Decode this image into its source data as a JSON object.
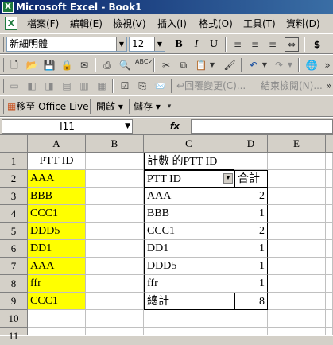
{
  "app": {
    "title": "Microsoft Excel - Book1",
    "logo_glyph": "X"
  },
  "menu": {
    "doc_glyph": "X",
    "items": [
      "檔案(F)",
      "編輯(E)",
      "檢視(V)",
      "插入(I)",
      "格式(O)",
      "工具(T)",
      "資料(D)"
    ]
  },
  "format_toolbar": {
    "font_name": "新細明體",
    "font_size": "12",
    "bold": "B",
    "italic": "I",
    "underline": "U",
    "dollar": "$"
  },
  "review_toolbar": {
    "reply_label": "回覆變更(C)...",
    "end_review_label": "結束檢閱(N)..."
  },
  "office_live_toolbar": {
    "goto_label": "移至 Office Live",
    "open_label": "開啟 ▾",
    "save_label": "儲存 ▾"
  },
  "formula_bar": {
    "name_box": "I11",
    "fx_label": "fx",
    "content": ""
  },
  "sheet": {
    "columns": [
      "A",
      "B",
      "C",
      "D",
      "E"
    ],
    "rows": [
      "1",
      "2",
      "3",
      "4",
      "5",
      "6",
      "7",
      "8",
      "9",
      "10",
      "11"
    ],
    "colA": [
      "PTT ID",
      "AAA",
      "BBB",
      "CCC1",
      "DDD5",
      "DD1",
      "AAA",
      "ffr",
      "CCC1"
    ],
    "pivot": {
      "title": "計數 的PTT ID",
      "row_field": "PTT ID",
      "total_header": "合計",
      "labels": [
        "AAA",
        "BBB",
        "CCC1",
        "DD1",
        "DDD5",
        "ffr"
      ],
      "counts": [
        "2",
        "1",
        "2",
        "1",
        "1",
        "1"
      ],
      "grand_total_label": "總計",
      "grand_total": "8"
    },
    "highlight_color": "#ffff00"
  }
}
